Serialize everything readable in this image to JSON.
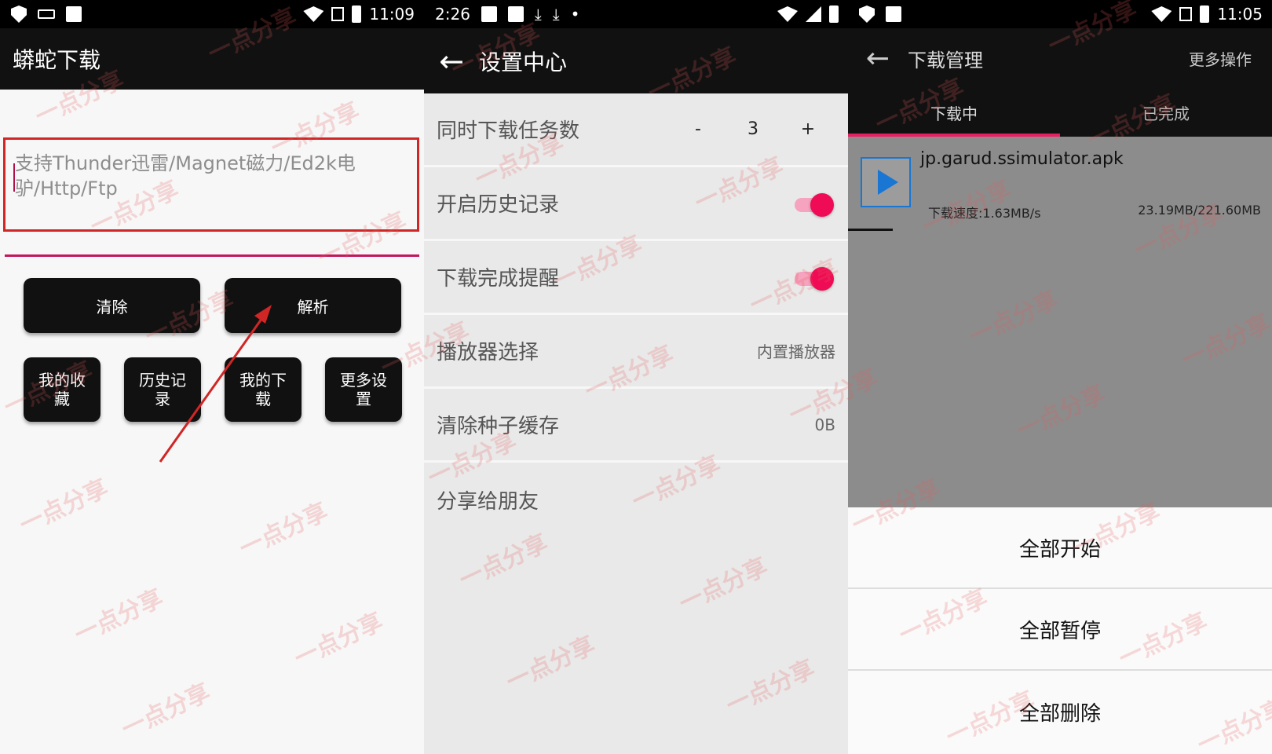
{
  "panel1": {
    "status_time": "11:09",
    "title": "蟒蛇下载",
    "input_placeholder": "支持Thunder迅雷/Magnet磁力/Ed2k电驴/Http/Ftp",
    "clear_label": "清除",
    "parse_label": "解析",
    "favorites_label": "我的收藏",
    "history_label": "历史记录",
    "downloads_label": "我的下载",
    "more_settings_label": "更多设置"
  },
  "panel2": {
    "status_time": "2:26",
    "title": "设置中心",
    "settings": [
      {
        "label": "同时下载任务数",
        "minus": "-",
        "value": "3",
        "plus": "+"
      },
      {
        "label": "开启历史记录"
      },
      {
        "label": "下载完成提醒"
      },
      {
        "label": "播放器选择",
        "value": "内置播放器"
      },
      {
        "label": "清除种子缓存",
        "value": "0B"
      },
      {
        "label": "分享给朋友"
      }
    ],
    "history_enabled": true,
    "completion_reminder_enabled": true
  },
  "panel3": {
    "status_time": "11:05",
    "title": "下载管理",
    "more_ops": "更多操作",
    "tabs": [
      "下载中",
      "已完成"
    ],
    "active_tab": 0,
    "item": {
      "name": "jp.garud.ssimulator.apk",
      "speed": "下载速度:1.63MB/s",
      "size": "23.19MB/221.60MB",
      "progress": 0.105
    },
    "actions": [
      "全部开始",
      "全部暂停",
      "全部删除"
    ]
  },
  "watermark_text": "一点分享",
  "colors": {
    "accent": "#e91e63",
    "highlight_box": "#d02626",
    "toggle_knob": "#ef0b55",
    "play_icon": "#1976d2"
  }
}
